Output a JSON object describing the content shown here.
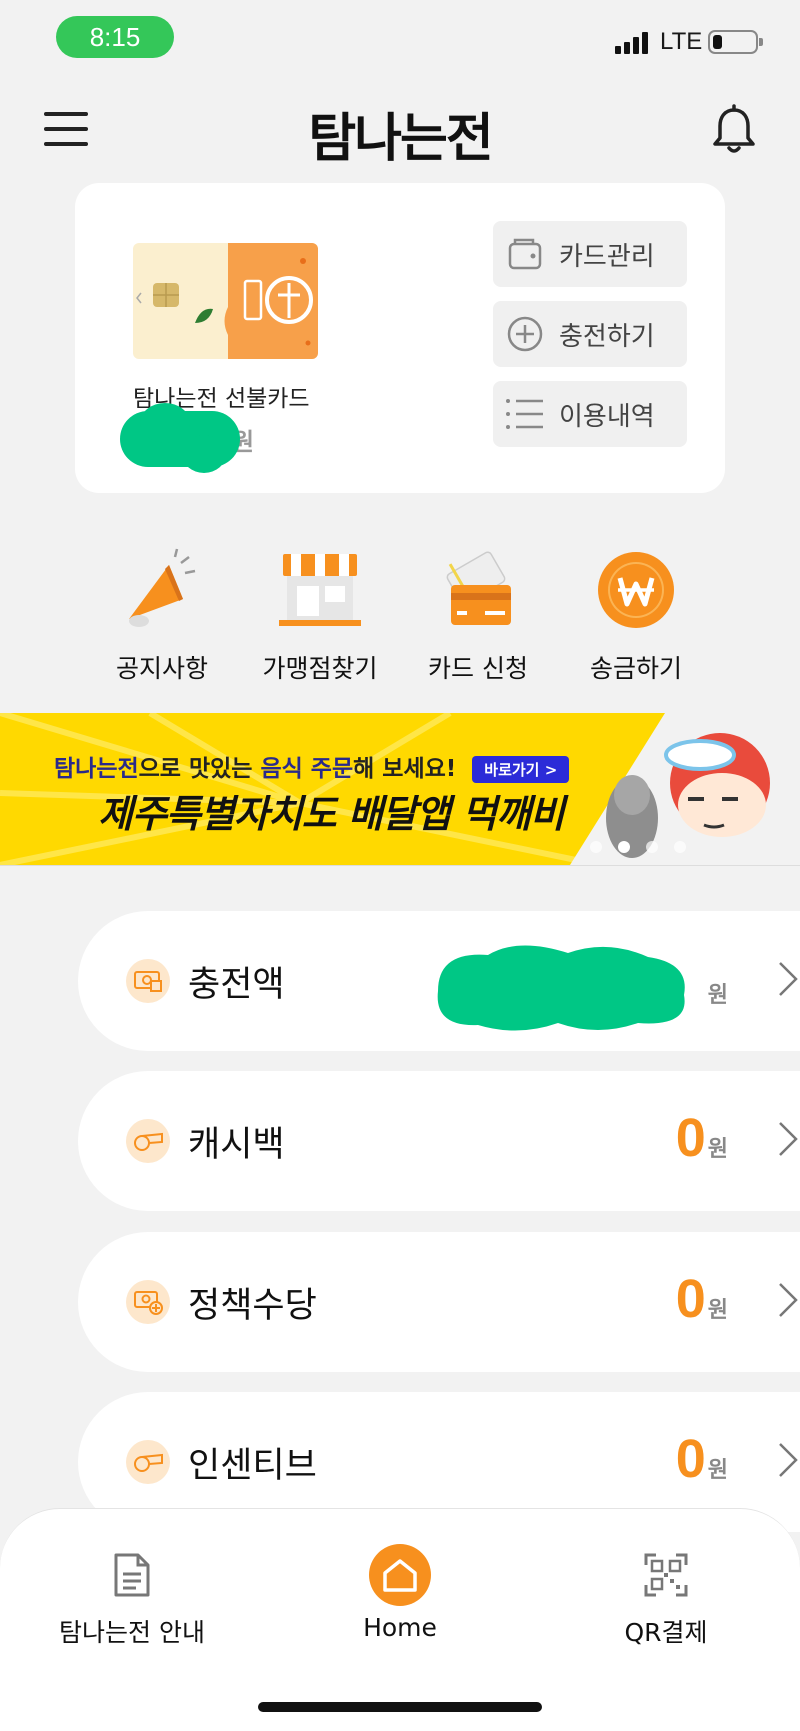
{
  "status_bar": {
    "time": "8:15",
    "network": "LTE"
  },
  "header": {
    "title": "탐나는전"
  },
  "card": {
    "name": "탐나는전 선불카드",
    "balance_unit": "원",
    "actions": [
      {
        "label": "카드관리",
        "icon": "wallet-icon"
      },
      {
        "label": "충전하기",
        "icon": "plus-circle-icon"
      },
      {
        "label": "이용내역",
        "icon": "list-icon"
      }
    ]
  },
  "quick_menu": [
    {
      "label": "공지사항",
      "icon": "megaphone-icon"
    },
    {
      "label": "가맹점찾기",
      "icon": "store-icon"
    },
    {
      "label": "카드 신청",
      "icon": "card-apply-icon"
    },
    {
      "label": "송금하기",
      "icon": "won-coin-icon"
    }
  ],
  "banner": {
    "line1_brand": "탐나는전",
    "line1_middle": "으로 맛있는 ",
    "line1_highlight": "음식 주문",
    "line1_end": "해 보세요!",
    "button_label": "바로가기 >",
    "line2": "제주특별자치도 배달앱 먹깨비"
  },
  "balances": [
    {
      "label": "충전액",
      "value": "",
      "unit": "원",
      "icon": "money-icon"
    },
    {
      "label": "캐시백",
      "value": "0",
      "unit": "원",
      "icon": "whistle-icon"
    },
    {
      "label": "정책수당",
      "value": "0",
      "unit": "원",
      "icon": "money-plus-icon"
    },
    {
      "label": "인센티브",
      "value": "0",
      "unit": "원",
      "icon": "whistle-icon"
    }
  ],
  "bottom_nav": [
    {
      "label": "탐나는전 안내",
      "icon": "document-icon"
    },
    {
      "label": "Home",
      "icon": "home-icon"
    },
    {
      "label": "QR결제",
      "icon": "qr-icon"
    }
  ],
  "colors": {
    "accent": "#f7901e",
    "status_green": "#34c759",
    "banner_yellow": "#ffd900",
    "redaction_green": "#00c785"
  }
}
